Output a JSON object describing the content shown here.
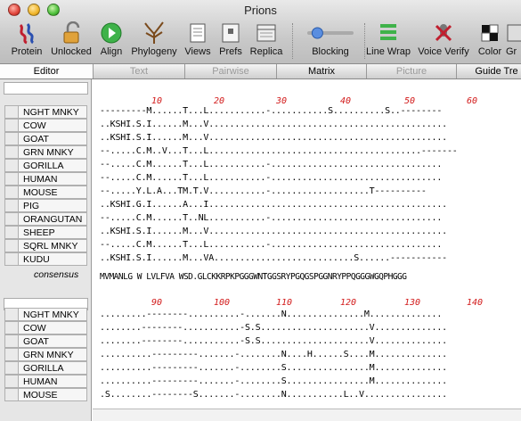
{
  "window": {
    "title": "Prions"
  },
  "toolbar": {
    "items": [
      {
        "label": "Protein",
        "icon": "protein-icon"
      },
      {
        "label": "Unlocked",
        "icon": "lock-icon"
      },
      {
        "label": "Align",
        "icon": "align-icon"
      },
      {
        "label": "Phylogeny",
        "icon": "tree-icon"
      },
      {
        "label": "Views",
        "icon": "views-icon"
      },
      {
        "label": "Prefs",
        "icon": "prefs-icon"
      },
      {
        "label": "Replica",
        "icon": "replica-icon"
      },
      {
        "label": "Blocking",
        "icon": "slider-icon"
      },
      {
        "label": "Line Wrap",
        "icon": "linewrap-icon"
      },
      {
        "label": "Voice Verify",
        "icon": "voice-icon"
      },
      {
        "label": "Color",
        "icon": "color-icon"
      },
      {
        "label": "Gr",
        "icon": "graph-icon"
      }
    ],
    "blocking_level": 0.2
  },
  "tabs": [
    {
      "label": "Editor",
      "state": "active"
    },
    {
      "label": "Text",
      "state": "disabled"
    },
    {
      "label": "Pairwise",
      "state": "disabled"
    },
    {
      "label": "Matrix",
      "state": "enabled"
    },
    {
      "label": "Picture",
      "state": "disabled"
    },
    {
      "label": "Guide Tre",
      "state": "enabled"
    }
  ],
  "block1": {
    "ruler": [
      "10",
      "20",
      "30",
      "40",
      "50",
      "60"
    ],
    "names": [
      "NGHT MNKY",
      "COW",
      "GOAT",
      "GRN MNKY",
      "GORILLA",
      "HUMAN",
      "MOUSE",
      "PIG",
      "ORANGUTAN",
      "SHEEP",
      "SQRL MNKY",
      "KUDU"
    ],
    "seqs": [
      "---------M......T...L...........-...........S..........S..--------",
      "..KSHI.S.I......M...V..............................................",
      "..KSHI.S.I......M...V..............................................",
      "--.....C.M..V...T...L.........................................-------",
      "--.....C.M......T...L...........-.................................",
      "--.....C.M......T...L...........-.................................",
      "--.....Y.L.A...TM.T.V...........-...................T----------",
      "..KSHI.G.I......A...I..............................................",
      "--.....C.M......T..NL...........-.................................",
      "..KSHI.S.I......M...V..............................................",
      "--.....C.M......T...L...........-.................................",
      "..KSHI.S.I......M...VA...........................S......-----------"
    ],
    "consensus_label": "consensus",
    "consensus": "MVMANLG W LVLFVA WSD.GLCKKRPKPGGGWNTGGSRYPGQGSPGGNRYPPQGGGWGQPHGGG"
  },
  "block2": {
    "ruler": [
      "90",
      "100",
      "110",
      "120",
      "130",
      "140"
    ],
    "names": [
      "NGHT MNKY",
      "COW",
      "GOAT",
      "GRN MNKY",
      "GORILLA",
      "HUMAN",
      "MOUSE"
    ],
    "seqs": [
      ".........--------..........-.......N...............M..............",
      "........--------...........-S.S.....................V..............",
      "........--------...........-S.S.....................V..............",
      "..........---------.......-........N....H......S....M..............",
      "..........---------.......-........S................M..............",
      "..........---------.......-........S................M..............",
      ".S........--------S.......-........N...........L..V................"
    ]
  }
}
